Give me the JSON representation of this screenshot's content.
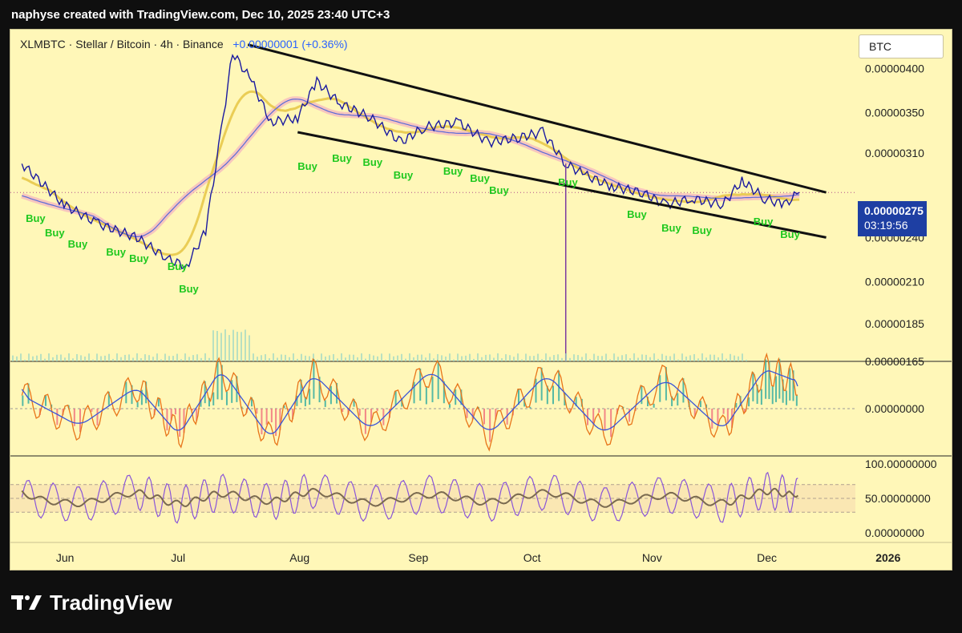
{
  "header": {
    "attribution": "naphyse created with TradingView.com, Dec 10, 2025 23:40 UTC+3"
  },
  "legend": {
    "symbol_line": "XLMBTC · Stellar / Bitcoin · 4h · Binance",
    "change": "+0.00000001 (+0.36%)"
  },
  "unit_button": "BTC",
  "price_tag": {
    "price": "0.00000275",
    "countdown": "03:19:56"
  },
  "footer": {
    "brand": "TradingView"
  },
  "colors": {
    "background": "#fff7b8",
    "candles": "#1a1aa0",
    "trendline": "#111111",
    "buy_label": "#1ec81e",
    "macd_line": "#e8751a",
    "signal_line": "#3a55d8",
    "rsi_line": "#8a55d8",
    "rsi_avg": "#7a6a50"
  },
  "chart_data": [
    {
      "type": "line",
      "title": "",
      "xlabel": "",
      "ylabel": "",
      "x_ticks": [
        "Jun",
        "Jul",
        "Aug",
        "Sep",
        "Oct",
        "Nov",
        "Dec",
        "2026"
      ],
      "y_ticks": [
        "0.00000400",
        "0.00000350",
        "0.00000310",
        "0.00000275",
        "0.00000240",
        "0.00000210",
        "0.00000185",
        "0.00000165"
      ],
      "y_scale": "log",
      "ylim": [
        1.65e-06,
        4.5e-06
      ],
      "current_price": 2.75e-06,
      "series": [
        {
          "x": [
            "2025-05-21",
            "2025-06-01",
            "2025-06-10",
            "2025-06-20",
            "2025-06-28",
            "2025-07-03",
            "2025-07-08",
            "2025-07-12",
            "2025-07-15",
            "2025-07-20",
            "2025-07-25",
            "2025-08-01",
            "2025-08-06",
            "2025-08-12",
            "2025-08-20",
            "2025-08-28",
            "2025-09-03",
            "2025-09-12",
            "2025-09-20",
            "2025-09-28",
            "2025-10-04",
            "2025-10-10",
            "2025-10-15",
            "2025-10-22",
            "2025-10-30",
            "2025-11-05",
            "2025-11-12",
            "2025-11-20",
            "2025-11-25",
            "2025-12-01",
            "2025-12-06",
            "2025-12-10"
          ],
          "y": [
            3e-06,
            2.65e-06,
            2.5e-06,
            2.4e-06,
            2.25e-06,
            2.2e-06,
            2.45e-06,
            3.3e-06,
            4.2e-06,
            3.85e-06,
            3.4e-06,
            3.45e-06,
            3.85e-06,
            3.6e-06,
            3.45e-06,
            3.2e-06,
            3.35e-06,
            3.4e-06,
            3.2e-06,
            3.25e-06,
            3.3e-06,
            3e-06,
            2.9e-06,
            2.8e-06,
            2.75e-06,
            2.65e-06,
            2.7e-06,
            2.65e-06,
            2.85e-06,
            2.7e-06,
            2.65e-06,
            2.75e-06
          ]
        }
      ],
      "annotations": {
        "buy_labels": [
          "Buy",
          "Buy",
          "Buy",
          "Buy",
          "Buy",
          "Buy",
          "Buy",
          "Buy",
          "Buy",
          "Buy",
          "Buy",
          "Buy",
          "Buy",
          "Buy",
          "Buy",
          "Buy",
          "Buy",
          "Buy",
          "Buy",
          "Buy"
        ]
      },
      "trendlines": [
        {
          "label": "",
          "from": [
            "2025-07-19",
            4.3e-06
          ],
          "to": [
            "2025-12-17",
            2.75e-06
          ]
        },
        {
          "label": "",
          "from": [
            "2025-08-01",
            3.3e-06
          ],
          "to": [
            "2025-12-17",
            2.4e-06
          ]
        }
      ]
    },
    {
      "type": "area",
      "title": "",
      "y_ticks": [
        "0.00000000"
      ],
      "x": [
        "2025-05-21",
        "2025-06-05",
        "2025-06-20",
        "2025-07-01",
        "2025-07-12",
        "2025-07-25",
        "2025-08-05",
        "2025-08-20",
        "2025-09-05",
        "2025-09-20",
        "2025-10-05",
        "2025-10-20",
        "2025-11-05",
        "2025-11-20",
        "2025-12-01",
        "2025-12-10"
      ],
      "series": [
        {
          "name": "",
          "values": [
            0.3,
            -0.4,
            0.5,
            -0.6,
            0.9,
            -0.7,
            0.8,
            -0.5,
            0.9,
            -0.6,
            0.8,
            -0.6,
            0.7,
            -0.5,
            0.9,
            0.6
          ]
        }
      ]
    },
    {
      "type": "line",
      "title": "",
      "y_ticks": [
        "100.00000000",
        "50.00000000",
        "0.00000000"
      ],
      "ylim": [
        0,
        100
      ],
      "x": [
        "2025-05-21",
        "2025-06-05",
        "2025-06-20",
        "2025-07-01",
        "2025-07-12",
        "2025-07-25",
        "2025-08-05",
        "2025-08-20",
        "2025-09-05",
        "2025-09-20",
        "2025-10-05",
        "2025-10-20",
        "2025-11-05",
        "2025-11-20",
        "2025-12-01",
        "2025-12-10"
      ],
      "series": [
        {
          "name": "",
          "values": [
            55,
            20,
            85,
            15,
            80,
            30,
            90,
            20,
            75,
            25,
            85,
            15,
            70,
            20,
            90,
            60
          ]
        }
      ]
    }
  ]
}
